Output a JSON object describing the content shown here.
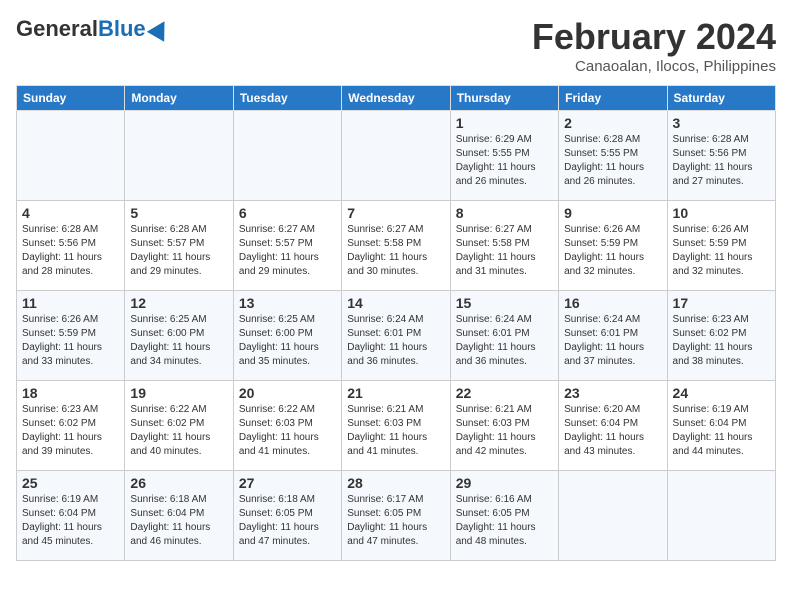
{
  "header": {
    "logo_general": "General",
    "logo_blue": "Blue",
    "month": "February 2024",
    "location": "Canaoalan, Ilocos, Philippines"
  },
  "days_of_week": [
    "Sunday",
    "Monday",
    "Tuesday",
    "Wednesday",
    "Thursday",
    "Friday",
    "Saturday"
  ],
  "weeks": [
    [
      {
        "day": "",
        "info": ""
      },
      {
        "day": "",
        "info": ""
      },
      {
        "day": "",
        "info": ""
      },
      {
        "day": "",
        "info": ""
      },
      {
        "day": "1",
        "info": "Sunrise: 6:29 AM\nSunset: 5:55 PM\nDaylight: 11 hours and 26 minutes."
      },
      {
        "day": "2",
        "info": "Sunrise: 6:28 AM\nSunset: 5:55 PM\nDaylight: 11 hours and 26 minutes."
      },
      {
        "day": "3",
        "info": "Sunrise: 6:28 AM\nSunset: 5:56 PM\nDaylight: 11 hours and 27 minutes."
      }
    ],
    [
      {
        "day": "4",
        "info": "Sunrise: 6:28 AM\nSunset: 5:56 PM\nDaylight: 11 hours and 28 minutes."
      },
      {
        "day": "5",
        "info": "Sunrise: 6:28 AM\nSunset: 5:57 PM\nDaylight: 11 hours and 29 minutes."
      },
      {
        "day": "6",
        "info": "Sunrise: 6:27 AM\nSunset: 5:57 PM\nDaylight: 11 hours and 29 minutes."
      },
      {
        "day": "7",
        "info": "Sunrise: 6:27 AM\nSunset: 5:58 PM\nDaylight: 11 hours and 30 minutes."
      },
      {
        "day": "8",
        "info": "Sunrise: 6:27 AM\nSunset: 5:58 PM\nDaylight: 11 hours and 31 minutes."
      },
      {
        "day": "9",
        "info": "Sunrise: 6:26 AM\nSunset: 5:59 PM\nDaylight: 11 hours and 32 minutes."
      },
      {
        "day": "10",
        "info": "Sunrise: 6:26 AM\nSunset: 5:59 PM\nDaylight: 11 hours and 32 minutes."
      }
    ],
    [
      {
        "day": "11",
        "info": "Sunrise: 6:26 AM\nSunset: 5:59 PM\nDaylight: 11 hours and 33 minutes."
      },
      {
        "day": "12",
        "info": "Sunrise: 6:25 AM\nSunset: 6:00 PM\nDaylight: 11 hours and 34 minutes."
      },
      {
        "day": "13",
        "info": "Sunrise: 6:25 AM\nSunset: 6:00 PM\nDaylight: 11 hours and 35 minutes."
      },
      {
        "day": "14",
        "info": "Sunrise: 6:24 AM\nSunset: 6:01 PM\nDaylight: 11 hours and 36 minutes."
      },
      {
        "day": "15",
        "info": "Sunrise: 6:24 AM\nSunset: 6:01 PM\nDaylight: 11 hours and 36 minutes."
      },
      {
        "day": "16",
        "info": "Sunrise: 6:24 AM\nSunset: 6:01 PM\nDaylight: 11 hours and 37 minutes."
      },
      {
        "day": "17",
        "info": "Sunrise: 6:23 AM\nSunset: 6:02 PM\nDaylight: 11 hours and 38 minutes."
      }
    ],
    [
      {
        "day": "18",
        "info": "Sunrise: 6:23 AM\nSunset: 6:02 PM\nDaylight: 11 hours and 39 minutes."
      },
      {
        "day": "19",
        "info": "Sunrise: 6:22 AM\nSunset: 6:02 PM\nDaylight: 11 hours and 40 minutes."
      },
      {
        "day": "20",
        "info": "Sunrise: 6:22 AM\nSunset: 6:03 PM\nDaylight: 11 hours and 41 minutes."
      },
      {
        "day": "21",
        "info": "Sunrise: 6:21 AM\nSunset: 6:03 PM\nDaylight: 11 hours and 41 minutes."
      },
      {
        "day": "22",
        "info": "Sunrise: 6:21 AM\nSunset: 6:03 PM\nDaylight: 11 hours and 42 minutes."
      },
      {
        "day": "23",
        "info": "Sunrise: 6:20 AM\nSunset: 6:04 PM\nDaylight: 11 hours and 43 minutes."
      },
      {
        "day": "24",
        "info": "Sunrise: 6:19 AM\nSunset: 6:04 PM\nDaylight: 11 hours and 44 minutes."
      }
    ],
    [
      {
        "day": "25",
        "info": "Sunrise: 6:19 AM\nSunset: 6:04 PM\nDaylight: 11 hours and 45 minutes."
      },
      {
        "day": "26",
        "info": "Sunrise: 6:18 AM\nSunset: 6:04 PM\nDaylight: 11 hours and 46 minutes."
      },
      {
        "day": "27",
        "info": "Sunrise: 6:18 AM\nSunset: 6:05 PM\nDaylight: 11 hours and 47 minutes."
      },
      {
        "day": "28",
        "info": "Sunrise: 6:17 AM\nSunset: 6:05 PM\nDaylight: 11 hours and 47 minutes."
      },
      {
        "day": "29",
        "info": "Sunrise: 6:16 AM\nSunset: 6:05 PM\nDaylight: 11 hours and 48 minutes."
      },
      {
        "day": "",
        "info": ""
      },
      {
        "day": "",
        "info": ""
      }
    ]
  ]
}
